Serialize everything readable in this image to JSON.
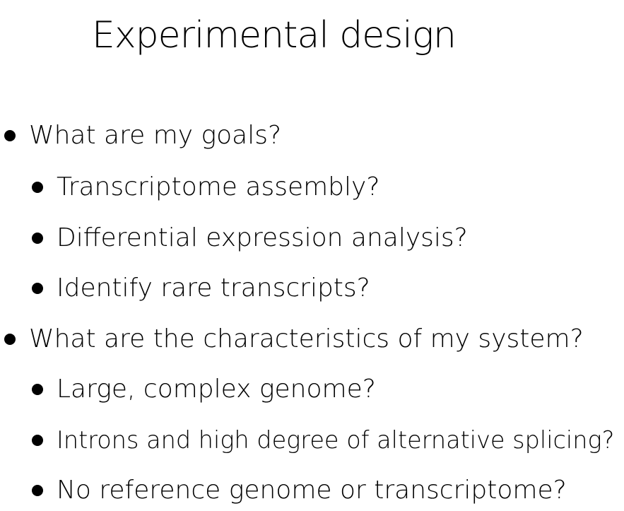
{
  "slide": {
    "title": "Experimental design",
    "bullets": [
      {
        "level": 1,
        "text": "What are my goals?"
      },
      {
        "level": 2,
        "text": "Transcriptome assembly?"
      },
      {
        "level": 2,
        "text": "Differential expression analysis?"
      },
      {
        "level": 2,
        "text": "Identify rare transcripts?"
      },
      {
        "level": 1,
        "text": "What are the characteristics of my system?"
      },
      {
        "level": 2,
        "text": "Large, complex genome?"
      },
      {
        "level": 2,
        "text": "Introns and high degree of alternative splicing?"
      },
      {
        "level": 2,
        "text": "No reference genome or transcriptome?"
      }
    ]
  }
}
